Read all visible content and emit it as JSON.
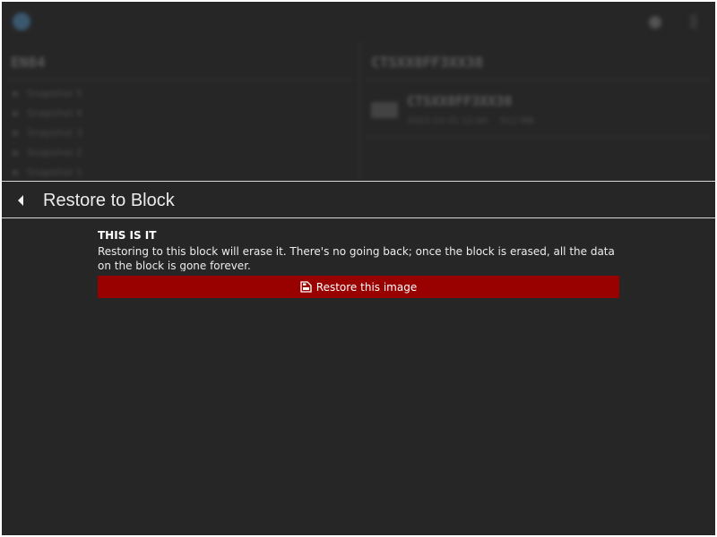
{
  "background": {
    "left_panel": {
      "title": "EN84",
      "items": [
        "Snapshot 5",
        "Snapshot 4",
        "Snapshot 3",
        "Snapshot 2",
        "Snapshot 1"
      ]
    },
    "right_panel": {
      "title": "CTSXX8FF3XX38",
      "card": {
        "title": "CTSXX8FF3XX38",
        "meta_left": "2023-10-31 12:00",
        "meta_right": "512 MB"
      }
    }
  },
  "dialog": {
    "title": "Restore to Block",
    "warning_heading": "THIS IS IT",
    "warning_text": "Restoring to this block will erase it. There's no going back; once the block is erased, all the data on the block is gone forever.",
    "restore_button_label": "Restore this image",
    "restore_button_icon": "file-restore-icon",
    "back_icon": "back-arrow-icon",
    "accent_color": "#990000"
  }
}
